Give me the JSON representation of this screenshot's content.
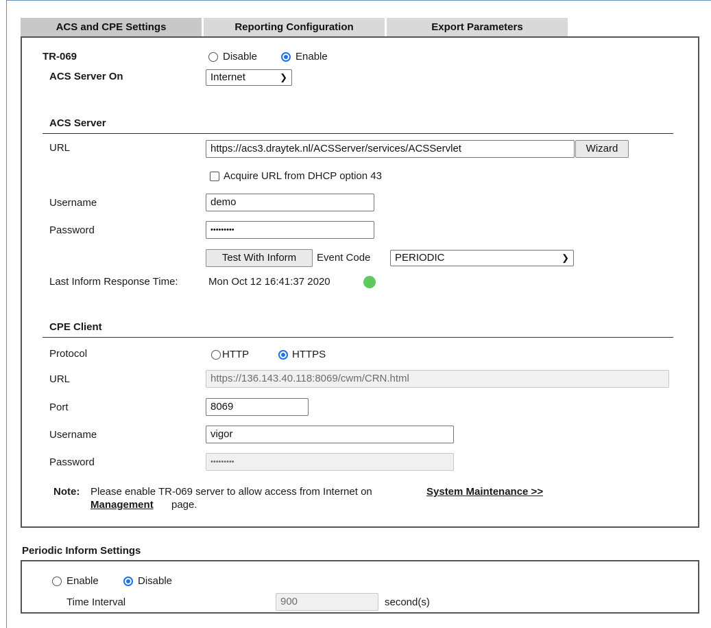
{
  "tabs": [
    "ACS and CPE Settings",
    "Reporting Configuration",
    "Export Parameters"
  ],
  "tr069": {
    "label": "TR-069",
    "option_disable": "Disable",
    "option_enable": "Enable",
    "selected": "Enable"
  },
  "acs_server_on": {
    "label": "ACS Server On",
    "value": "Internet"
  },
  "acs_server": {
    "heading": "ACS Server",
    "url_label": "URL",
    "url_value": "https://acs3.draytek.nl/ACSServer/services/ACSServlet",
    "wizard_label": "Wizard",
    "dhcp_label": "Acquire URL from DHCP option 43",
    "dhcp_checked": false,
    "username_label": "Username",
    "username_value": "demo",
    "password_label": "Password",
    "password_value": "•••••••••",
    "test_button": "Test With Inform",
    "event_code_label": "Event Code",
    "event_code_value": "PERIODIC",
    "last_inform_label": "Last Inform Response Time:",
    "last_inform_value": "Mon Oct 12 16:41:37 2020",
    "status_color": "#5ec95e"
  },
  "cpe_client": {
    "heading": "CPE Client",
    "protocol_label": "Protocol",
    "option_http": "HTTP",
    "option_https": "HTTPS",
    "selected": "HTTPS",
    "url_label": "URL",
    "url_value": "https://136.143.40.118:8069/cwm/CRN.html",
    "port_label": "Port",
    "port_value": "8069",
    "username_label": "Username",
    "username_value": "vigor",
    "password_label": "Password",
    "password_value": "•••••••••"
  },
  "note": {
    "prefix": "Note:",
    "text": "Please enable TR-069 server to allow access from Internet on",
    "link_line1": "System Maintenance >>",
    "link_line2": "Management",
    "suffix": "page."
  },
  "periodic": {
    "heading": "Periodic Inform Settings",
    "option_enable": "Enable",
    "option_disable": "Disable",
    "selected": "Disable",
    "interval_label": "Time Interval",
    "interval_value": "900",
    "unit": "second(s)"
  }
}
